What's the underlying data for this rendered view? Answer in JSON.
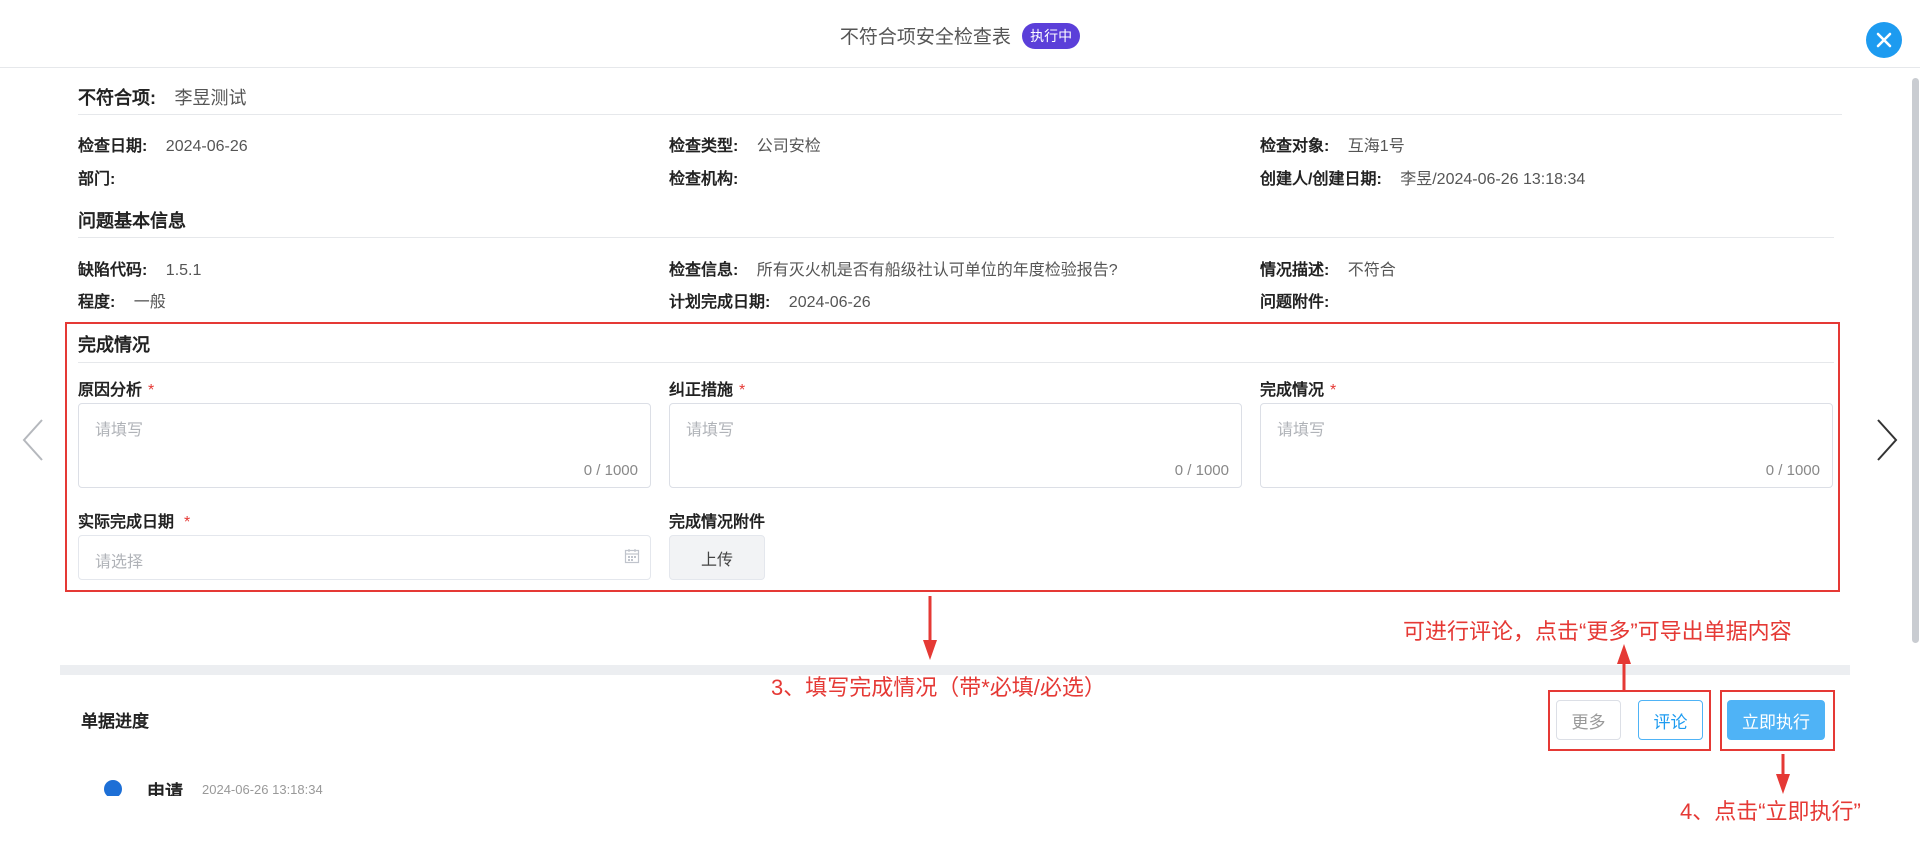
{
  "header": {
    "title": "不符合项安全检查表",
    "status_badge": "执行中"
  },
  "item": {
    "label": "不符合项:",
    "value": "李昱测试"
  },
  "info": {
    "check_date_label": "检查日期:",
    "check_date": "2024-06-26",
    "check_type_label": "检查类型:",
    "check_type": "公司安检",
    "check_target_label": "检查对象:",
    "check_target": "互海1号",
    "dept_label": "部门:",
    "dept": "",
    "org_label": "检查机构:",
    "org": "",
    "creator_label": "创建人/创建日期:",
    "creator": "李昱/2024-06-26 13:18:34"
  },
  "problem": {
    "section_title": "问题基本信息",
    "defect_code_label": "缺陷代码:",
    "defect_code": "1.5.1",
    "check_info_label": "检查信息:",
    "check_info": "所有灭火机是否有船级社认可单位的年度检验报告?",
    "desc_label": "情况描述:",
    "desc": "不符合",
    "degree_label": "程度:",
    "degree": "一般",
    "plan_date_label": "计划完成日期:",
    "plan_date": "2024-06-26",
    "attach_label": "问题附件:"
  },
  "completion": {
    "section_title": "完成情况",
    "cause_label": "原因分析",
    "measure_label": "纠正措施",
    "status_label": "完成情况",
    "required_mark": "*",
    "placeholder": "请填写",
    "counter": "0 / 1000",
    "actual_date_label": "实际完成日期",
    "date_placeholder": "请选择",
    "attach_label": "完成情况附件",
    "upload_label": "上传"
  },
  "annotations": {
    "step3": "3、填写完成情况（带*必填/必选）",
    "more_hint": "可进行评论，点击“更多”可导出单据内容",
    "step4": "4、点击“立即执行”"
  },
  "actions": {
    "more": "更多",
    "comment": "评论",
    "execute": "立即执行"
  },
  "progress": {
    "title": "单据进度",
    "first_step": "申请",
    "first_step_time": "2024-06-26 13:18:34"
  },
  "colors": {
    "accent": "#1d9bf0",
    "badge": "#5b3fd9",
    "annotation_red": "#e53935"
  }
}
